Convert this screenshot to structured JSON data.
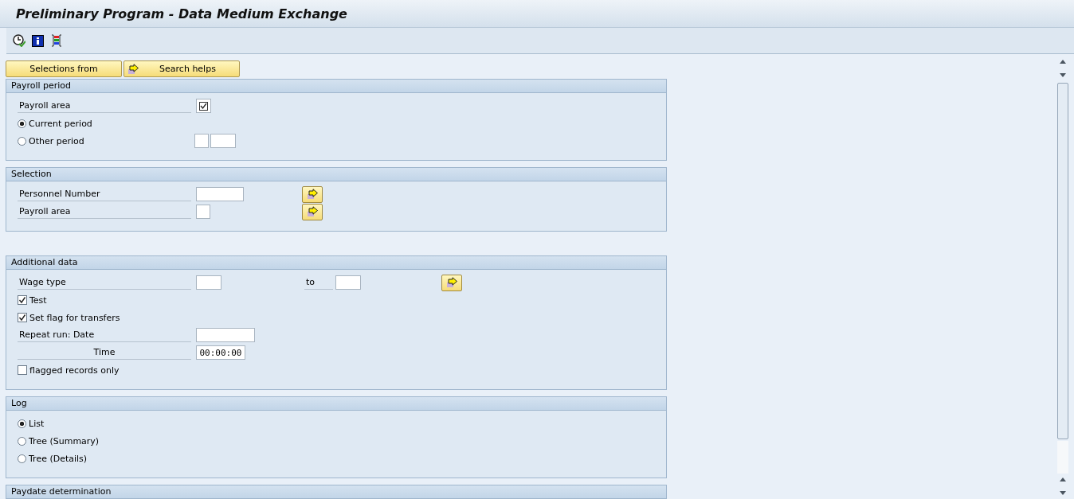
{
  "window": {
    "title": "Preliminary Program - Data Medium Exchange"
  },
  "buttons": [
    {
      "label": "Selections from",
      "icon": false
    },
    {
      "label": "Search helps",
      "icon": true
    }
  ],
  "sections": [
    {
      "title": "Payroll period",
      "rows": [
        {
          "kind": "flag",
          "label": "Payroll area",
          "checked": true
        },
        {
          "kind": "radio",
          "label": "Current period",
          "selected": true
        },
        {
          "kind": "radio_period",
          "label": "Other period",
          "selected": false
        }
      ]
    },
    {
      "title": "Selection",
      "rows": [
        {
          "kind": "select",
          "label": "Personnel Number"
        },
        {
          "kind": "select",
          "label": "Payroll area"
        }
      ]
    },
    {
      "title": "Additional data",
      "rows": [
        {
          "kind": "range",
          "label": "Wage type",
          "to": "to"
        },
        {
          "kind": "checkbox",
          "label": "Test",
          "checked": true
        },
        {
          "kind": "checkbox",
          "label": "Set flag for transfers",
          "checked": true
        },
        {
          "kind": "field",
          "label": "Repeat run: Date"
        },
        {
          "kind": "subfield",
          "label": "Time",
          "value": "00:00:00"
        },
        {
          "kind": "checkbox",
          "label": "flagged records only",
          "checked": false
        }
      ]
    },
    {
      "title": "Log",
      "rows": [
        {
          "kind": "radio",
          "label": "List",
          "selected": true
        },
        {
          "kind": "radio",
          "label": "Tree (Summary)",
          "selected": false
        },
        {
          "kind": "radio",
          "label": "Tree (Details)",
          "selected": false
        }
      ]
    },
    {
      "title": "Paydate determination"
    }
  ]
}
